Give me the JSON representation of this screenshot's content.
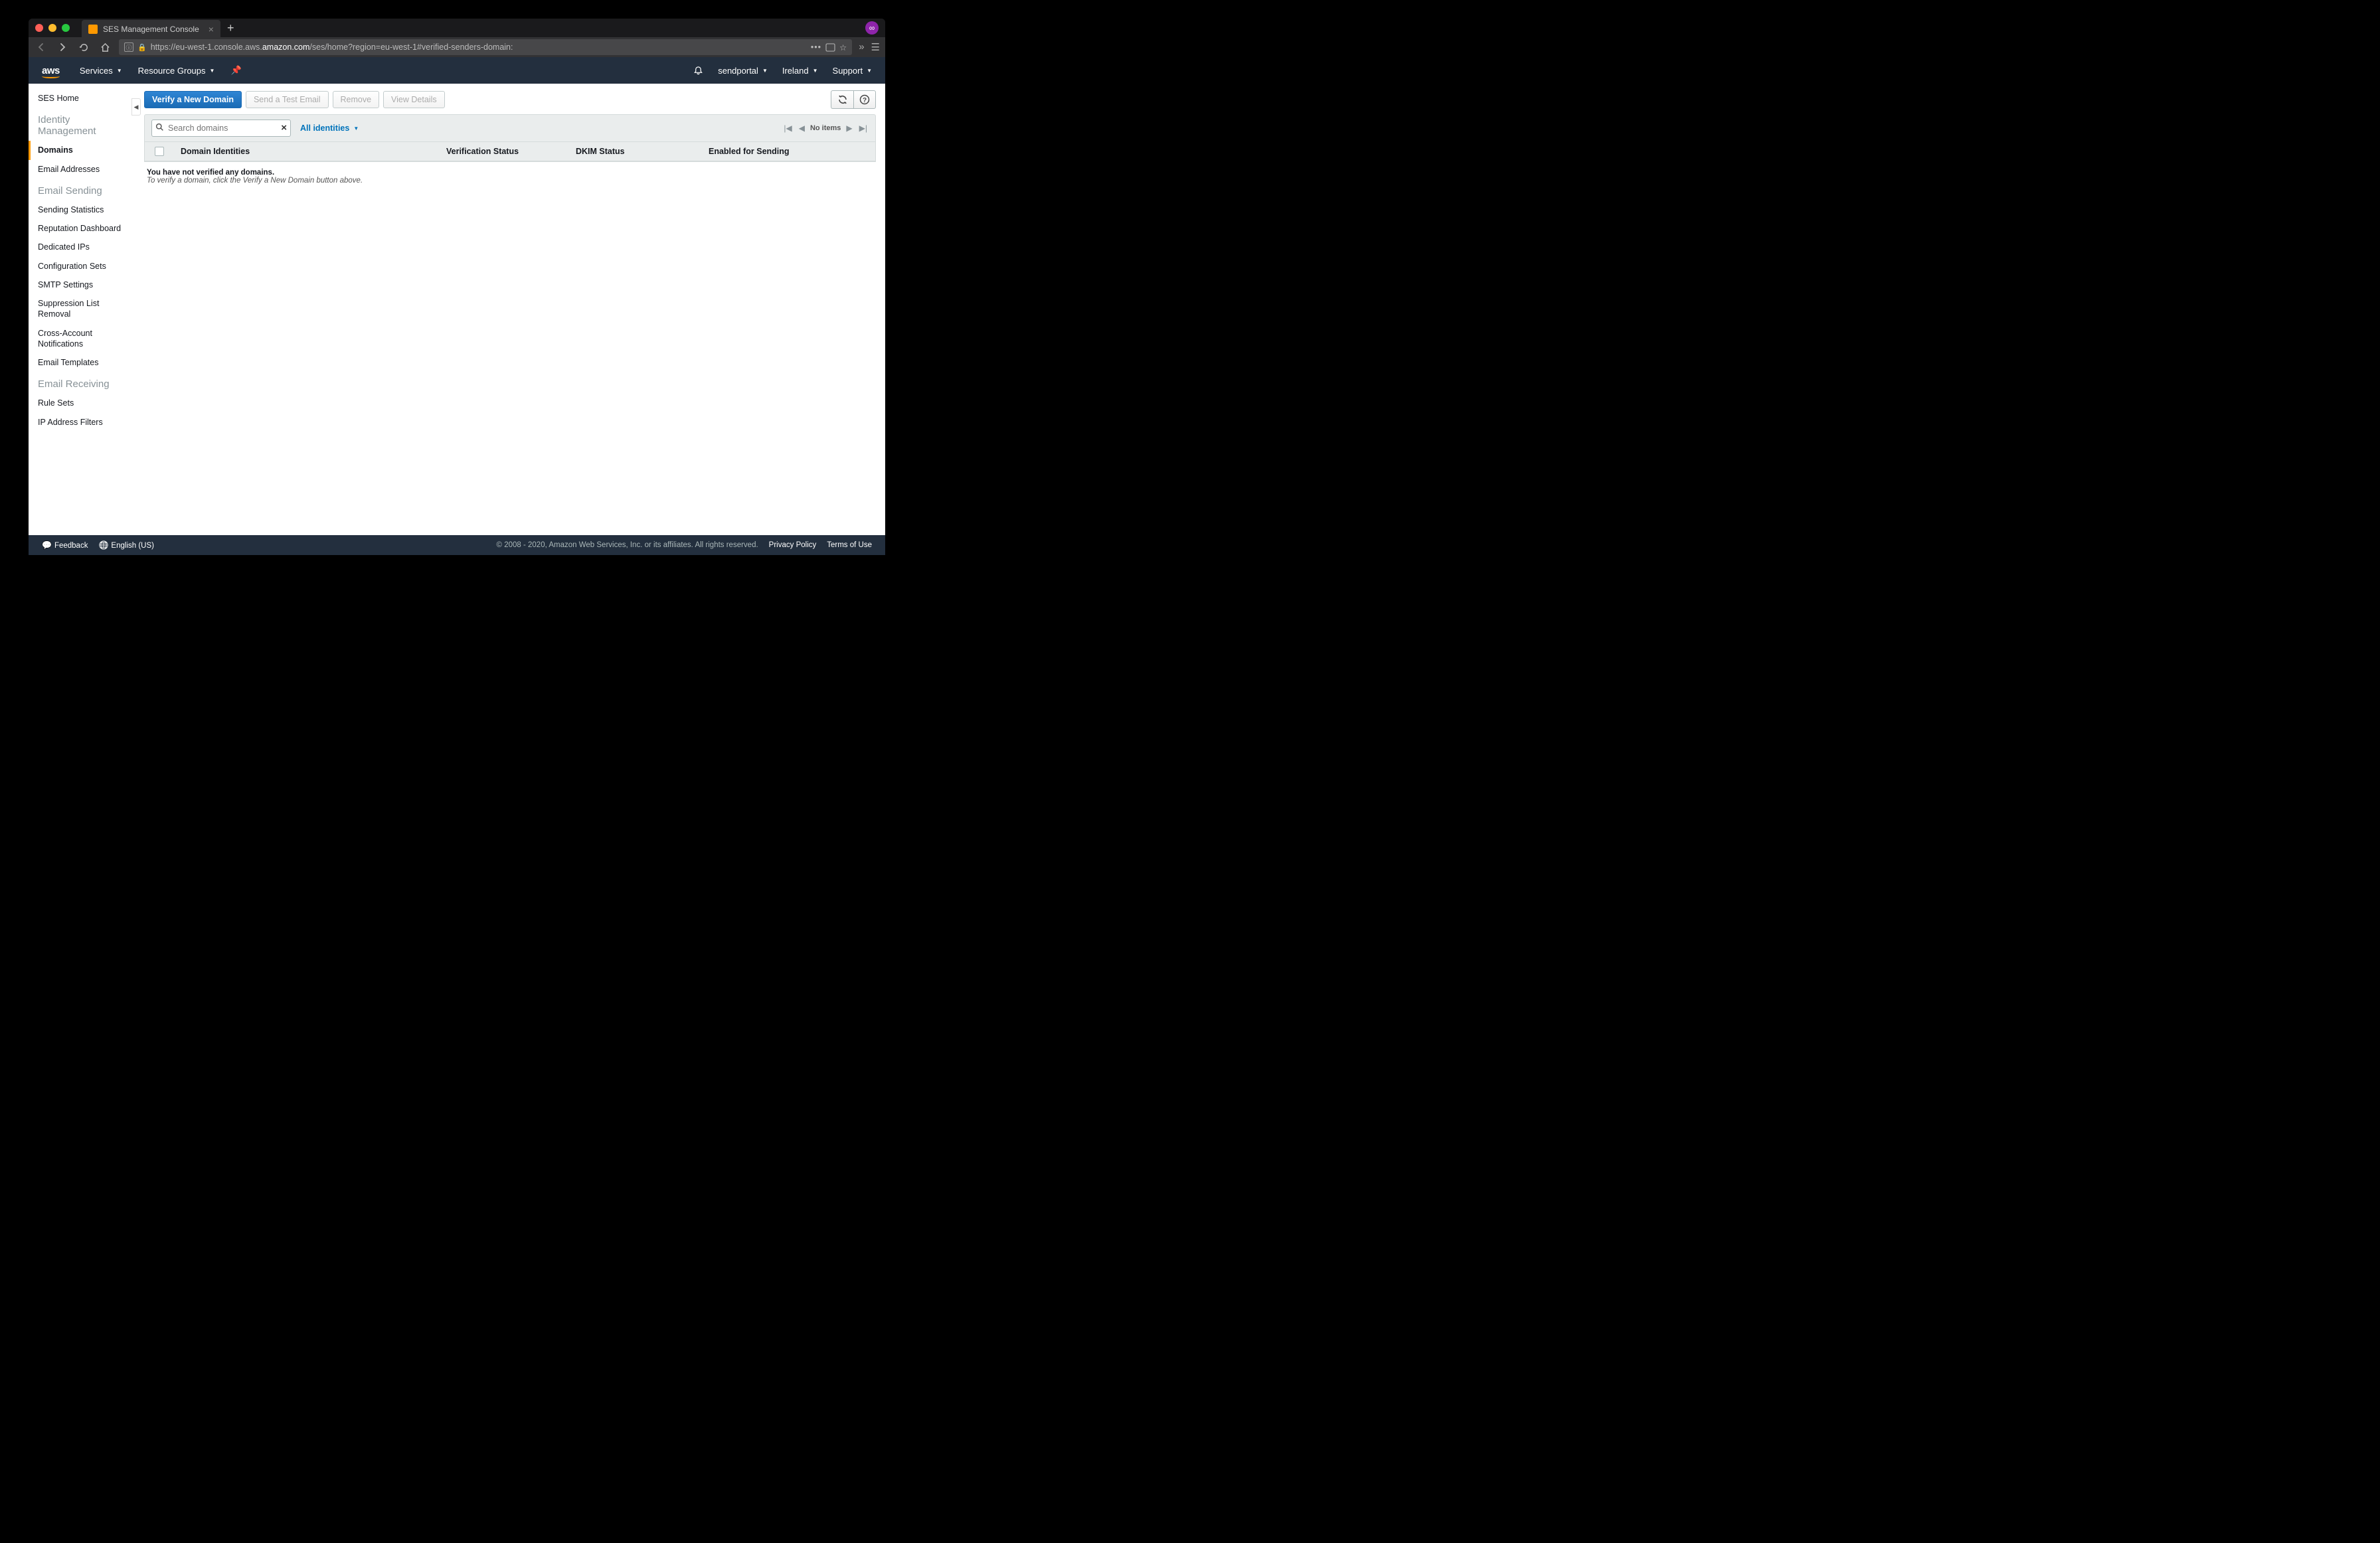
{
  "browser": {
    "tab_title": "SES Management Console",
    "url_prefix": "https://eu-west-1.console.aws.",
    "url_domain": "amazon.com",
    "url_suffix": "/ses/home?region=eu-west-1#verified-senders-domain:"
  },
  "header": {
    "logo": "aws",
    "services": "Services",
    "resource_groups": "Resource Groups",
    "account": "sendportal",
    "region": "Ireland",
    "support": "Support"
  },
  "sidebar": {
    "ses_home": "SES Home",
    "identity_heading": "Identity Management",
    "domains": "Domains",
    "email_addresses": "Email Addresses",
    "sending_heading": "Email Sending",
    "sending_items": [
      "Sending Statistics",
      "Reputation Dashboard",
      "Dedicated IPs",
      "Configuration Sets",
      "SMTP Settings",
      "Suppression List Removal",
      "Cross-Account Notifications",
      "Email Templates"
    ],
    "receiving_heading": "Email Receiving",
    "receiving_items": [
      "Rule Sets",
      "IP Address Filters"
    ]
  },
  "actions": {
    "verify": "Verify a New Domain",
    "send_test": "Send a Test Email",
    "remove": "Remove",
    "view_details": "View Details"
  },
  "filter": {
    "search_placeholder": "Search domains",
    "all_identities": "All identities",
    "no_items": "No items"
  },
  "table": {
    "col_domain": "Domain Identities",
    "col_verification": "Verification Status",
    "col_dkim": "DKIM Status",
    "col_enabled": "Enabled for Sending"
  },
  "empty": {
    "line1": "You have not verified any domains.",
    "line2": "To verify a domain, click the Verify a New Domain button above."
  },
  "footer": {
    "feedback": "Feedback",
    "language": "English (US)",
    "copyright": "© 2008 - 2020, Amazon Web Services, Inc. or its affiliates. All rights reserved.",
    "privacy": "Privacy Policy",
    "terms": "Terms of Use"
  }
}
